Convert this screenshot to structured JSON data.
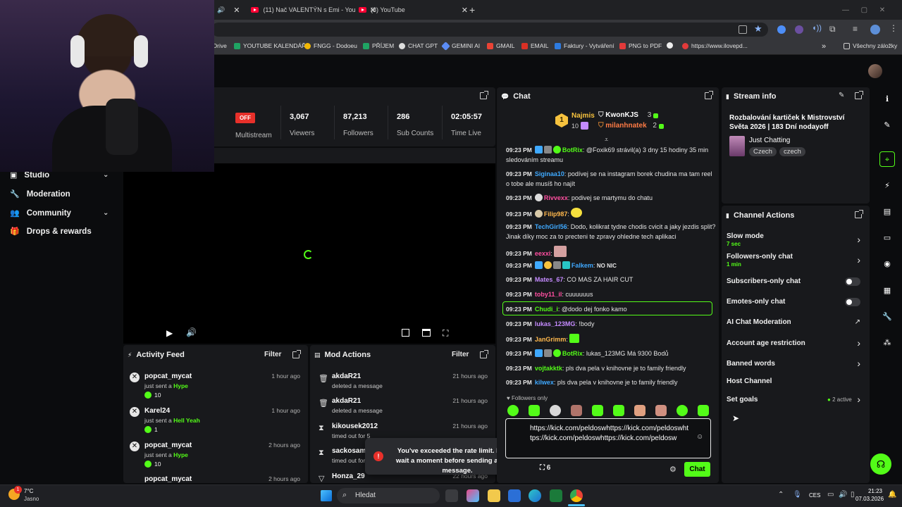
{
  "browser": {
    "tabs": [
      {
        "label": "(11) Nač VALENTÝN s Emi - You",
        "has_close": true
      },
      {
        "label": "(3) YouTube",
        "has_close": true
      }
    ],
    "new_tab_label": "+",
    "bookmarks": [
      {
        "label": "Drive"
      },
      {
        "label": "YOUTUBE KALENDÁŘ"
      },
      {
        "label": "FNGG - Dodoeu"
      },
      {
        "label": "PŘÍJEM"
      },
      {
        "label": "CHAT GPT"
      },
      {
        "label": "GEMINI AI"
      },
      {
        "label": "GMAIL"
      },
      {
        "label": "EMAIL"
      },
      {
        "label": "Faktury - Vytváření"
      },
      {
        "label": "PNG to PDF"
      },
      {
        "label": "https://www.ilovepd..."
      }
    ],
    "all_bookmarks_label": "Všechny záložky",
    "more_label": "»"
  },
  "sidebar": {
    "items": [
      {
        "label": "Studio",
        "icon": "studio-icon",
        "has_chevron": true
      },
      {
        "label": "Moderation",
        "icon": "wrench-icon",
        "has_chevron": false
      },
      {
        "label": "Community",
        "icon": "users-icon",
        "has_chevron": true
      },
      {
        "label": "Drops & rewards",
        "icon": "gift-icon",
        "has_chevron": false
      }
    ]
  },
  "stats": {
    "multistream_status": "OFF",
    "multistream_label": "Multistream",
    "viewers": {
      "value": "3,067",
      "label": "Viewers"
    },
    "followers": {
      "value": "87,213",
      "label": "Followers"
    },
    "subs": {
      "value": "286",
      "label": "Sub Counts"
    },
    "time": {
      "value": "02:05:57",
      "label": "Time Live"
    }
  },
  "activity_feed": {
    "title": "Activity Feed",
    "filter_label": "Filter",
    "items": [
      {
        "name": "popcat_mycat",
        "action": "just sent a",
        "item": "Hype",
        "amount": "10",
        "time": "1 hour ago"
      },
      {
        "name": "Karel24",
        "action": "just sent a",
        "item": "Hell Yeah",
        "amount": "1",
        "time": "1 hour ago"
      },
      {
        "name": "popcat_mycat",
        "action": "just sent a",
        "item": "Hype",
        "amount": "10",
        "time": "2 hours ago"
      },
      {
        "name": "popcat_mycat",
        "action": "",
        "item": "",
        "amount": "",
        "time": "2 hours ago"
      }
    ]
  },
  "mod_actions": {
    "title": "Mod Actions",
    "filter_label": "Filter",
    "items": [
      {
        "name": "akdaR21",
        "action": "deleted a message",
        "time": "21 hours ago",
        "icon": "trash-icon"
      },
      {
        "name": "akdaR21",
        "action": "deleted a message",
        "time": "21 hours ago",
        "icon": "trash-icon"
      },
      {
        "name": "kikousek2012",
        "action": "timed out for 5",
        "time": "21 hours ago",
        "icon": "hourglass-icon"
      },
      {
        "name": "sackosamo",
        "action": "timed out for",
        "time": "",
        "icon": "hourglass-icon"
      },
      {
        "name": "Honza_29",
        "action": "",
        "time": "22 hours ago",
        "icon": "chevron-icon"
      }
    ]
  },
  "toast": {
    "text": "You've exceeded the rate limit. Please wait a moment before sending another message."
  },
  "chat": {
    "title": "Chat",
    "leaderboard": {
      "rank": "1",
      "first_name": "Najmis",
      "first_count": "10",
      "second_name": "KwonKJS",
      "second_count": "3",
      "third_name": "milanhnatek",
      "third_count": "2"
    },
    "messages": [
      {
        "time": "09:23 PM",
        "user": "BotRix",
        "color": "#53fc18",
        "text": "@Foxik69 strávil(a) 3 dny 15 hodiny 35 min sledováním streamu"
      },
      {
        "time": "09:23 PM",
        "user": "Siginaa10",
        "color": "#3fa9ff",
        "text": "podívej se na instagram borek chudina ma tam reel o tobe ale musíš ho najít"
      },
      {
        "time": "09:23 PM",
        "user": "Rivvexx",
        "color": "#ff4fa0",
        "text": "podivej se martymu do chatu"
      },
      {
        "time": "09:23 PM",
        "user": "Filip987",
        "color": "#ffb84d",
        "text": ""
      },
      {
        "time": "09:23 PM",
        "user": "TechGirl56",
        "color": "#3fa9ff",
        "text": "Dodo, kolikrat tydne chodis cvicit a jaky jezdis split? Jinak díky moc za to precteni te zpravy ohledne tech aplikaci"
      },
      {
        "time": "09:23 PM",
        "user": "eexxi",
        "color": "#ff4fa0",
        "text": ""
      },
      {
        "time": "09:23 PM",
        "user": "Falkem",
        "color": "#3fa9ff",
        "text": "NO NIC"
      },
      {
        "time": "09:23 PM",
        "user": "Mates_67",
        "color": "#c58bff",
        "text": "CO MAS ZA HAIR CUT"
      },
      {
        "time": "09:23 PM",
        "user": "toby11_il",
        "color": "#ff4fa0",
        "text": "cuuuuuus"
      },
      {
        "time": "09:23 PM",
        "user": "Chudi_i",
        "color": "#53fc18",
        "text": "@dodo dej fonko kamo"
      },
      {
        "time": "09:23 PM",
        "user": "lukas_123MG",
        "color": "#c58bff",
        "text": "!body"
      },
      {
        "time": "09:23 PM",
        "user": "JanGrimm",
        "color": "#ffb84d",
        "text": ""
      },
      {
        "time": "09:23 PM",
        "user": "BotRix",
        "color": "#53fc18",
        "text": "lukas_123MG Má 9300 Bodů"
      },
      {
        "time": "09:23 PM",
        "user": "vojtakktk",
        "color": "#53fc18",
        "text": "pls dva pela v knihovne je to family friendly"
      },
      {
        "time": "09:23 PM",
        "user": "kilwex",
        "color": "#3fa9ff",
        "text": "pls dva pela v knihovne je to family friendly"
      }
    ],
    "followers_only_label": "Followers only",
    "input_value": "https://kick.com/peldoswhttps://kick.com/peldoswhttps://kick.com/peldoswhttps://kick.com/peldosw",
    "points_count": "6",
    "send_label": "Chat"
  },
  "stream_info": {
    "title": "Stream info",
    "stream_title": "Rozbalování kartiček k Mistrovství Světa 2026 | 183 Dní nodayoff",
    "category": "Just Chatting",
    "tags": [
      "Czech",
      "czech"
    ]
  },
  "channel_actions": {
    "title": "Channel Actions",
    "rows": [
      {
        "label": "Slow mode",
        "sub": "7 sec",
        "control": "arrow"
      },
      {
        "label": "Followers-only chat",
        "sub": "1 min",
        "control": "arrow"
      },
      {
        "label": "Subscribers-only chat",
        "sub": "",
        "control": "toggle"
      },
      {
        "label": "Emotes-only chat",
        "sub": "",
        "control": "toggle"
      },
      {
        "label": "AI Chat Moderation",
        "sub": "",
        "control": "external"
      },
      {
        "label": "Account age restriction",
        "sub": "",
        "control": "arrow"
      },
      {
        "label": "Banned words",
        "sub": "",
        "control": "arrow"
      },
      {
        "label": "Host Channel",
        "sub": "",
        "control": "none"
      },
      {
        "label": "Set goals",
        "sub": "",
        "control": "arrow",
        "status": "2 active"
      }
    ]
  },
  "taskbar": {
    "weather_temp": "7°C",
    "weather_desc": "Jasno",
    "search_placeholder": "Hledat",
    "lang": "CES",
    "time": "21:23",
    "date": "07.03.2026",
    "notif_count": "1"
  },
  "colors": {
    "accent": "#53fc18",
    "panel": "#18191c",
    "bg": "#0b0c0e"
  }
}
